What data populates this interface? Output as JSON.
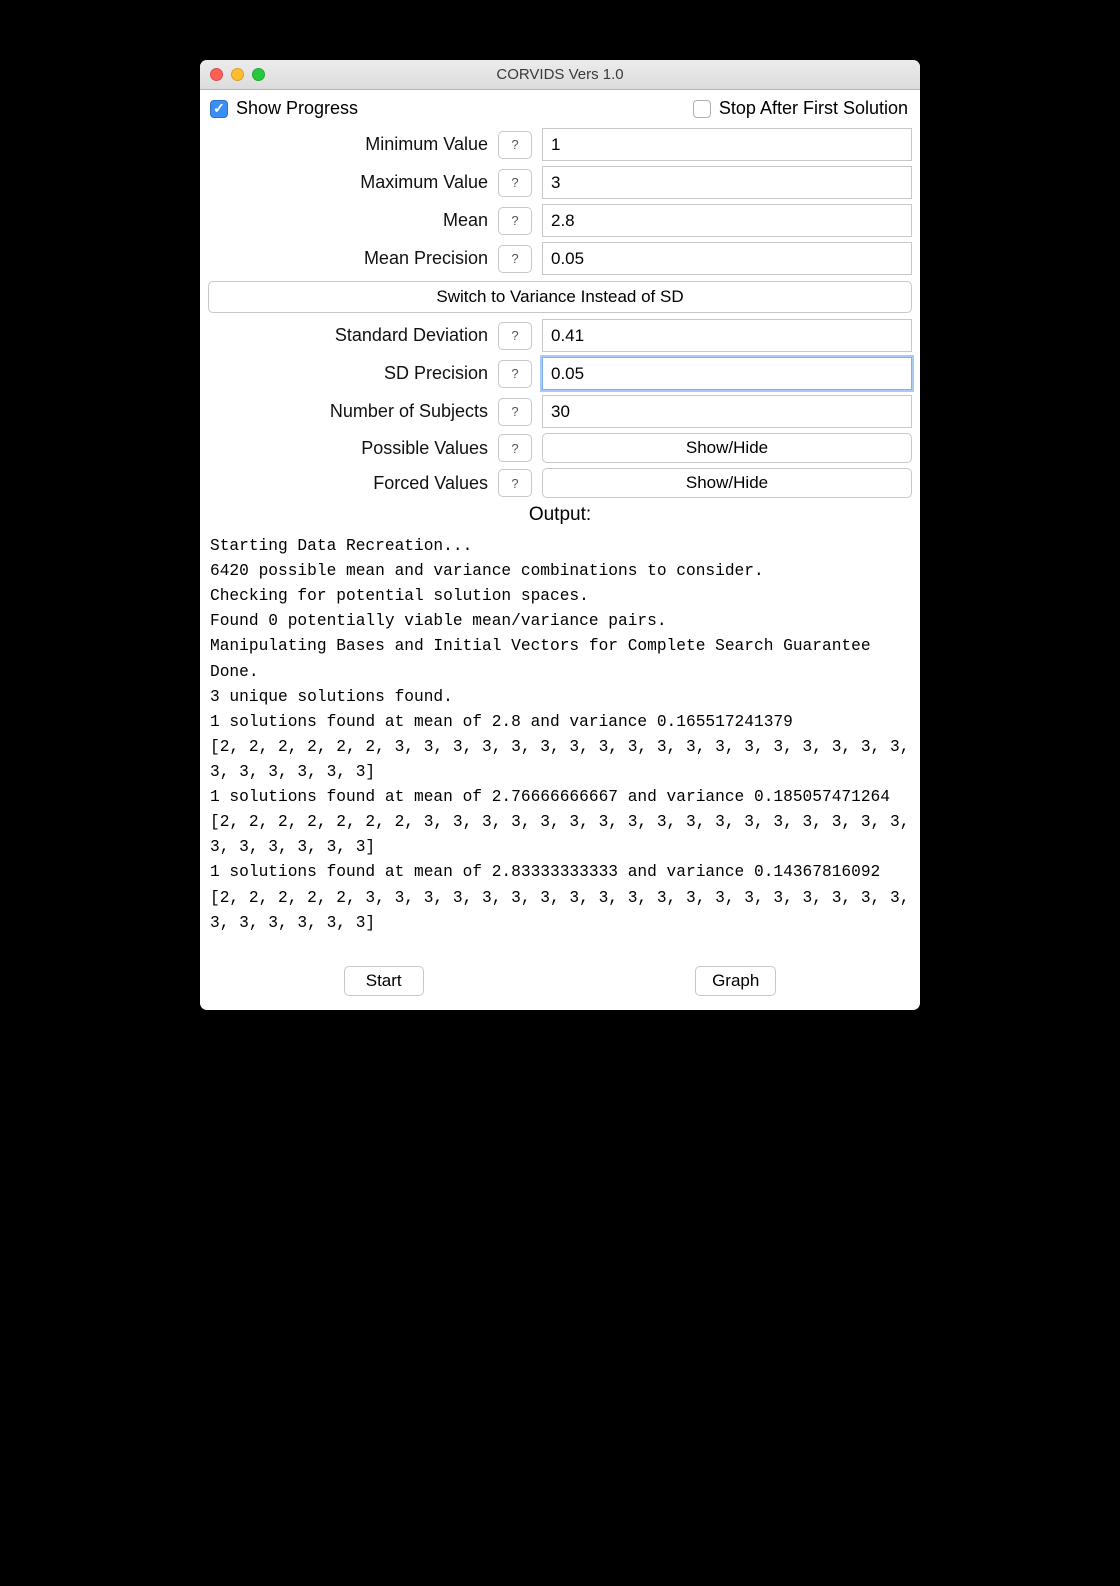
{
  "window": {
    "title": "CORVIDS Vers 1.0"
  },
  "checks": {
    "show_progress": {
      "label": "Show Progress",
      "checked": true
    },
    "stop_after_first": {
      "label": "Stop After First Solution",
      "checked": false
    }
  },
  "fields": {
    "min_value": {
      "label": "Minimum Value",
      "value": "1"
    },
    "max_value": {
      "label": "Maximum Value",
      "value": "3"
    },
    "mean": {
      "label": "Mean",
      "value": "2.8"
    },
    "mean_prec": {
      "label": "Mean Precision",
      "value": "0.05"
    },
    "sd": {
      "label": "Standard Deviation",
      "value": "0.41"
    },
    "sd_prec": {
      "label": "SD Precision",
      "value": "0.05"
    },
    "n_subjects": {
      "label": "Number of Subjects",
      "value": "30"
    },
    "possible": {
      "label": "Possible Values",
      "button": "Show/Hide"
    },
    "forced": {
      "label": "Forced Values",
      "button": "Show/Hide"
    }
  },
  "switch_button": "Switch to Variance Instead of SD",
  "help_glyph": "?",
  "output_label": "Output:",
  "output_text": "Starting Data Recreation...\n6420 possible mean and variance combinations to consider.\nChecking for potential solution spaces.\nFound 0 potentially viable mean/variance pairs.\nManipulating Bases and Initial Vectors for Complete Search Guarantee\nDone.\n3 unique solutions found.\n1 solutions found at mean of 2.8 and variance 0.165517241379\n[2, 2, 2, 2, 2, 2, 3, 3, 3, 3, 3, 3, 3, 3, 3, 3, 3, 3, 3, 3, 3, 3, 3, 3, 3, 3, 3, 3, 3, 3]\n1 solutions found at mean of 2.76666666667 and variance 0.185057471264\n[2, 2, 2, 2, 2, 2, 2, 3, 3, 3, 3, 3, 3, 3, 3, 3, 3, 3, 3, 3, 3, 3, 3, 3, 3, 3, 3, 3, 3, 3]\n1 solutions found at mean of 2.83333333333 and variance 0.14367816092\n[2, 2, 2, 2, 2, 3, 3, 3, 3, 3, 3, 3, 3, 3, 3, 3, 3, 3, 3, 3, 3, 3, 3, 3, 3, 3, 3, 3, 3, 3]",
  "buttons": {
    "start": "Start",
    "graph": "Graph"
  }
}
